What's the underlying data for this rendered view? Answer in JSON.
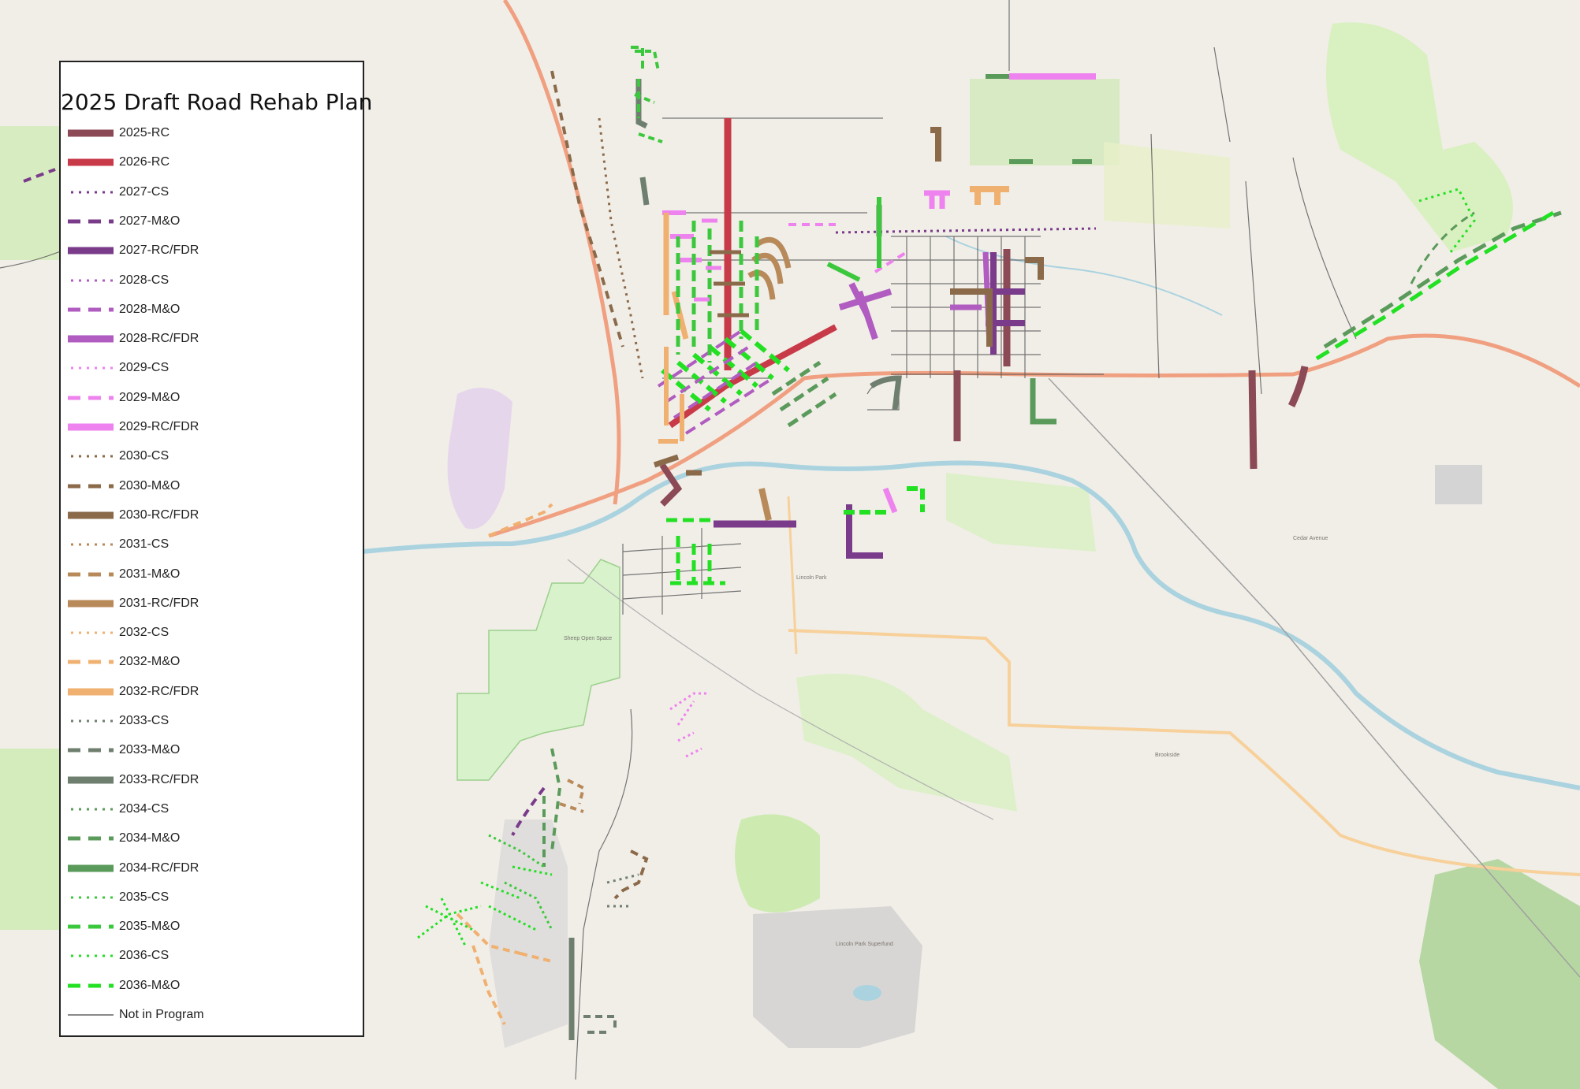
{
  "legend": {
    "title": "2025 Draft Road Rehab Plan",
    "items": [
      {
        "label": "2025-RC",
        "color": "#8b4a55",
        "style": "solid",
        "thick": "heavy"
      },
      {
        "label": "2026-RC",
        "color": "#c83a48",
        "style": "solid",
        "thick": "heavy"
      },
      {
        "label": "2027-CS",
        "color": "#7a3c8a",
        "style": "dotted",
        "thick": "thin"
      },
      {
        "label": "2027-M&O",
        "color": "#7a3c8a",
        "style": "dashed",
        "thick": "medium"
      },
      {
        "label": "2027-RC/FDR",
        "color": "#7a3c8a",
        "style": "solid",
        "thick": "heavy"
      },
      {
        "label": "2028-CS",
        "color": "#b05cc0",
        "style": "dotted",
        "thick": "thin"
      },
      {
        "label": "2028-M&O",
        "color": "#b05cc0",
        "style": "dashed",
        "thick": "medium"
      },
      {
        "label": "2028-RC/FDR",
        "color": "#b05cc0",
        "style": "solid",
        "thick": "heavy"
      },
      {
        "label": "2029-CS",
        "color": "#ee82ee",
        "style": "dotted",
        "thick": "thin"
      },
      {
        "label": "2029-M&O",
        "color": "#ee82ee",
        "style": "dashed",
        "thick": "medium"
      },
      {
        "label": "2029-RC/FDR",
        "color": "#ee82ee",
        "style": "solid",
        "thick": "heavy"
      },
      {
        "label": "2030-CS",
        "color": "#8b6a4a",
        "style": "dotted",
        "thick": "thin"
      },
      {
        "label": "2030-M&O",
        "color": "#8b6a4a",
        "style": "dashed",
        "thick": "medium"
      },
      {
        "label": "2030-RC/FDR",
        "color": "#8b6a4a",
        "style": "solid",
        "thick": "heavy"
      },
      {
        "label": "2031-CS",
        "color": "#b88a5a",
        "style": "dotted",
        "thick": "thin"
      },
      {
        "label": "2031-M&O",
        "color": "#b88a5a",
        "style": "dashed",
        "thick": "medium"
      },
      {
        "label": "2031-RC/FDR",
        "color": "#b88a5a",
        "style": "solid",
        "thick": "heavy"
      },
      {
        "label": "2032-CS",
        "color": "#f0b070",
        "style": "dotted",
        "thick": "thin"
      },
      {
        "label": "2032-M&O",
        "color": "#f0b070",
        "style": "dashed",
        "thick": "medium"
      },
      {
        "label": "2032-RC/FDR",
        "color": "#f0b070",
        "style": "solid",
        "thick": "heavy"
      },
      {
        "label": "2033-CS",
        "color": "#6f7f6f",
        "style": "dotted",
        "thick": "thin"
      },
      {
        "label": "2033-M&O",
        "color": "#6f7f6f",
        "style": "dashed",
        "thick": "medium"
      },
      {
        "label": "2033-RC/FDR",
        "color": "#6f7f6f",
        "style": "solid",
        "thick": "heavy"
      },
      {
        "label": "2034-CS",
        "color": "#5a9a5a",
        "style": "dotted",
        "thick": "thin"
      },
      {
        "label": "2034-M&O",
        "color": "#5a9a5a",
        "style": "dashed",
        "thick": "medium"
      },
      {
        "label": "2034-RC/FDR",
        "color": "#5a9a5a",
        "style": "solid",
        "thick": "heavy"
      },
      {
        "label": "2035-CS",
        "color": "#3cc83c",
        "style": "dotted",
        "thick": "thin"
      },
      {
        "label": "2035-M&O",
        "color": "#3cc83c",
        "style": "dashed",
        "thick": "medium"
      },
      {
        "label": "2036-CS",
        "color": "#22e022",
        "style": "dotted",
        "thick": "thin"
      },
      {
        "label": "2036-M&O",
        "color": "#22e022",
        "style": "dashed",
        "thick": "medium"
      },
      {
        "label": "Not in Program",
        "color": "#444444",
        "style": "solid",
        "thick": "hair"
      }
    ]
  },
  "basemap": {
    "background_color": "#f1eee8",
    "park_color": "#cdebb0",
    "forest_color": "#add19e",
    "water_color": "#aad3df",
    "highway_color": "#f0a080",
    "secondary_color": "#f7d09a"
  }
}
